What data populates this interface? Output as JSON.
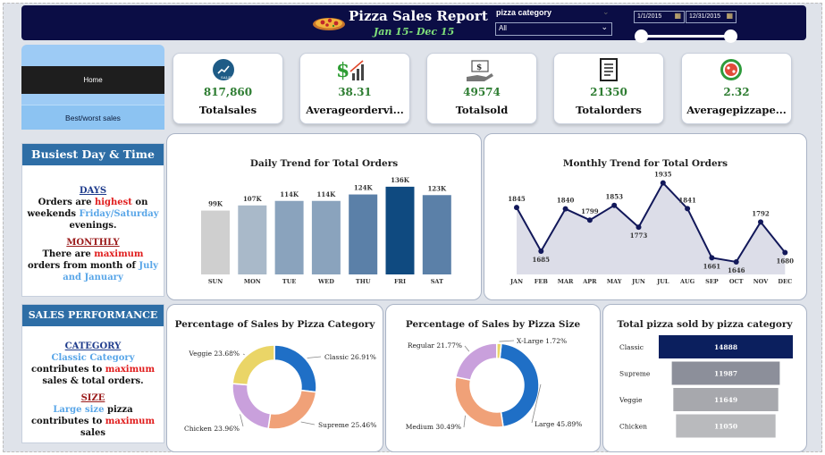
{
  "header": {
    "title": "Pizza Sales Report",
    "subtitle": "Jan 15- Dec 15",
    "slicer_label": "pizza category",
    "slicer_value": "All",
    "date_start": "1/1/2015",
    "date_end": "12/31/2015"
  },
  "sidebar": {
    "nav": [
      {
        "label": "Home",
        "active": true
      },
      {
        "label": "Best/worst sales",
        "active": false
      }
    ],
    "busiest": {
      "title": "Busiest Day & Time",
      "days_heading": "DAYS",
      "days_p1": "Orders are ",
      "days_highlight": "highest",
      "days_p2": " on weekends ",
      "days_blue": "Friday/Saturday",
      "days_p3": " evenings.",
      "monthly_heading": "MONTHLY",
      "monthly_p1": "There are ",
      "monthly_red": "maximum",
      "monthly_p2": " orders from month of ",
      "monthly_blue": "July and January"
    },
    "performance": {
      "title": "SALES PERFORMANCE",
      "category_heading": "CATEGORY",
      "category_blue": "Classic Category",
      "category_p1": " contributes to ",
      "category_red": "maximum",
      "category_p2": " sales & total orders.",
      "size_heading": "SIZE",
      "size_blue": "Large size",
      "size_p1": " pizza contributes to ",
      "size_red": "maximum",
      "size_p2": " sales"
    }
  },
  "kpis": [
    {
      "value": "817,860",
      "label": "Totalsales",
      "icon": "sales-chart-icon"
    },
    {
      "value": "38.31",
      "label": "Averageordervi...",
      "icon": "dollar-growth-icon"
    },
    {
      "value": "49574",
      "label": "Totalsold",
      "icon": "money-hand-icon"
    },
    {
      "value": "21350",
      "label": "Totalorders",
      "icon": "receipt-icon"
    },
    {
      "value": "2.32",
      "label": "Averagepizzape...",
      "icon": "pizza-icon"
    }
  ],
  "colors": {
    "header_bg": "#0b0d45",
    "accent_green": "#2e7d32",
    "panel_head": "#2e6ea6",
    "navy": "#1a1f5c"
  },
  "chart_data": [
    {
      "type": "bar",
      "title": "Daily Trend for Total Orders",
      "categories": [
        "SUN",
        "MON",
        "TUE",
        "WED",
        "THU",
        "FRI",
        "SAT"
      ],
      "values": [
        99,
        107,
        114,
        114,
        124,
        136,
        123
      ],
      "data_labels": [
        "99K",
        "107K",
        "114K",
        "114K",
        "124K",
        "136K",
        "123K"
      ],
      "colors": [
        "#cfcfcf",
        "#a9b9c9",
        "#8aa3bd",
        "#8aa3bd",
        "#5b80a8",
        "#0f4a80",
        "#5b80a8"
      ],
      "ylim": [
        0,
        140
      ]
    },
    {
      "type": "area",
      "title": "Monthly Trend for Total Orders",
      "categories": [
        "JAN",
        "FEB",
        "MAR",
        "APR",
        "MAY",
        "JUN",
        "JUL",
        "AUG",
        "SEP",
        "OCT",
        "NOV",
        "DEC"
      ],
      "values": [
        1845,
        1685,
        1840,
        1799,
        1853,
        1773,
        1935,
        1841,
        1661,
        1646,
        1792,
        1680
      ],
      "ylim": [
        1600,
        1960
      ]
    },
    {
      "type": "pie",
      "title": "Percentage of Sales by Pizza Category",
      "labels": [
        "Classic",
        "Supreme",
        "Chicken",
        "Veggie"
      ],
      "values": [
        26.91,
        25.46,
        23.96,
        23.68
      ],
      "display": [
        "Classic 26.91%",
        "Supreme 25.46%",
        "Chicken 23.96%",
        "Veggie 23.68%"
      ],
      "colors": [
        "#1f6fc6",
        "#f0a178",
        "#c9a0dc",
        "#ead567"
      ]
    },
    {
      "type": "pie",
      "title": "Percentage of Sales by Pizza Size",
      "labels": [
        "Large",
        "Medium",
        "Regular",
        "X-Large"
      ],
      "values": [
        45.89,
        30.49,
        21.77,
        1.72
      ],
      "display": [
        "Large 45.89%",
        "Medium 30.49%",
        "Regular 21.77%",
        "X-Large 1.72%"
      ],
      "colors": [
        "#1f6fc6",
        "#f0a178",
        "#c9a0dc",
        "#ead567"
      ]
    },
    {
      "type": "bar",
      "title": "Total pizza sold by pizza category",
      "categories": [
        "Classic",
        "Supreme",
        "Veggie",
        "Chicken"
      ],
      "values": [
        14888,
        11987,
        11649,
        11050
      ],
      "colors": [
        "#0b1f5e",
        "#8c8f9a",
        "#a7a8ad",
        "#b9babd"
      ]
    }
  ]
}
